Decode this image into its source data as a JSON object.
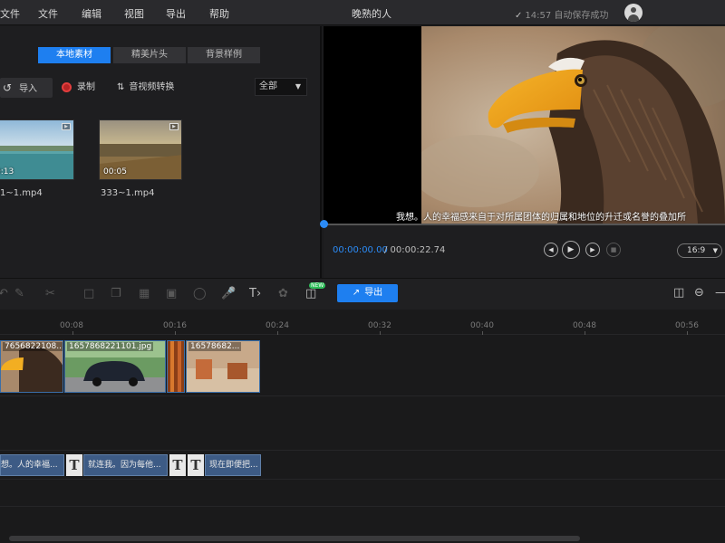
{
  "menu": {
    "items": [
      "文件",
      "文件",
      "编辑",
      "视图",
      "导出",
      "帮助"
    ]
  },
  "app_title": "晚熟的人",
  "save_status": {
    "check": "✓",
    "time": "14:57",
    "text": "自动保存成功"
  },
  "media": {
    "tabs": [
      {
        "label": "本地素材",
        "active": true
      },
      {
        "label": "精美片头",
        "active": false
      },
      {
        "label": "背景样例",
        "active": false
      }
    ],
    "import_label": "导入",
    "record_label": "录制",
    "convert_label": "音视频转换",
    "filter_value": "全部",
    "clips": [
      {
        "duration": "0:13",
        "name": "1~1.mp4"
      },
      {
        "duration": "00:05",
        "name": "333~1.mp4"
      }
    ]
  },
  "preview": {
    "subtitle": "我想。人的幸福感来自于对所属团体的归属和地位的升迁或名誉的叠加所",
    "time_current": "00:00:00.00",
    "time_total": "/ 00:00:22.74",
    "ratio": "16:9"
  },
  "toolbar": {
    "new_badge": "NEW",
    "export_label": "导出"
  },
  "timeline": {
    "ticks": [
      "00:08",
      "00:16",
      "00:24",
      "00:32",
      "00:40",
      "00:48",
      "00:56"
    ],
    "video_clips": [
      {
        "label": "7656822108..."
      },
      {
        "label": "1657868221101.jpg"
      },
      {
        "label": ""
      },
      {
        "label": "16578682..."
      }
    ],
    "subtitle_clips": [
      "想。人的幸福...",
      "就连我。因为每他...",
      "现在即便把..."
    ]
  },
  "colors": {
    "accent": "#1e7ff0",
    "record": "#e43e3e",
    "new_badge": "#2fbf5a",
    "subtitle_clip": "#3d5b85"
  }
}
